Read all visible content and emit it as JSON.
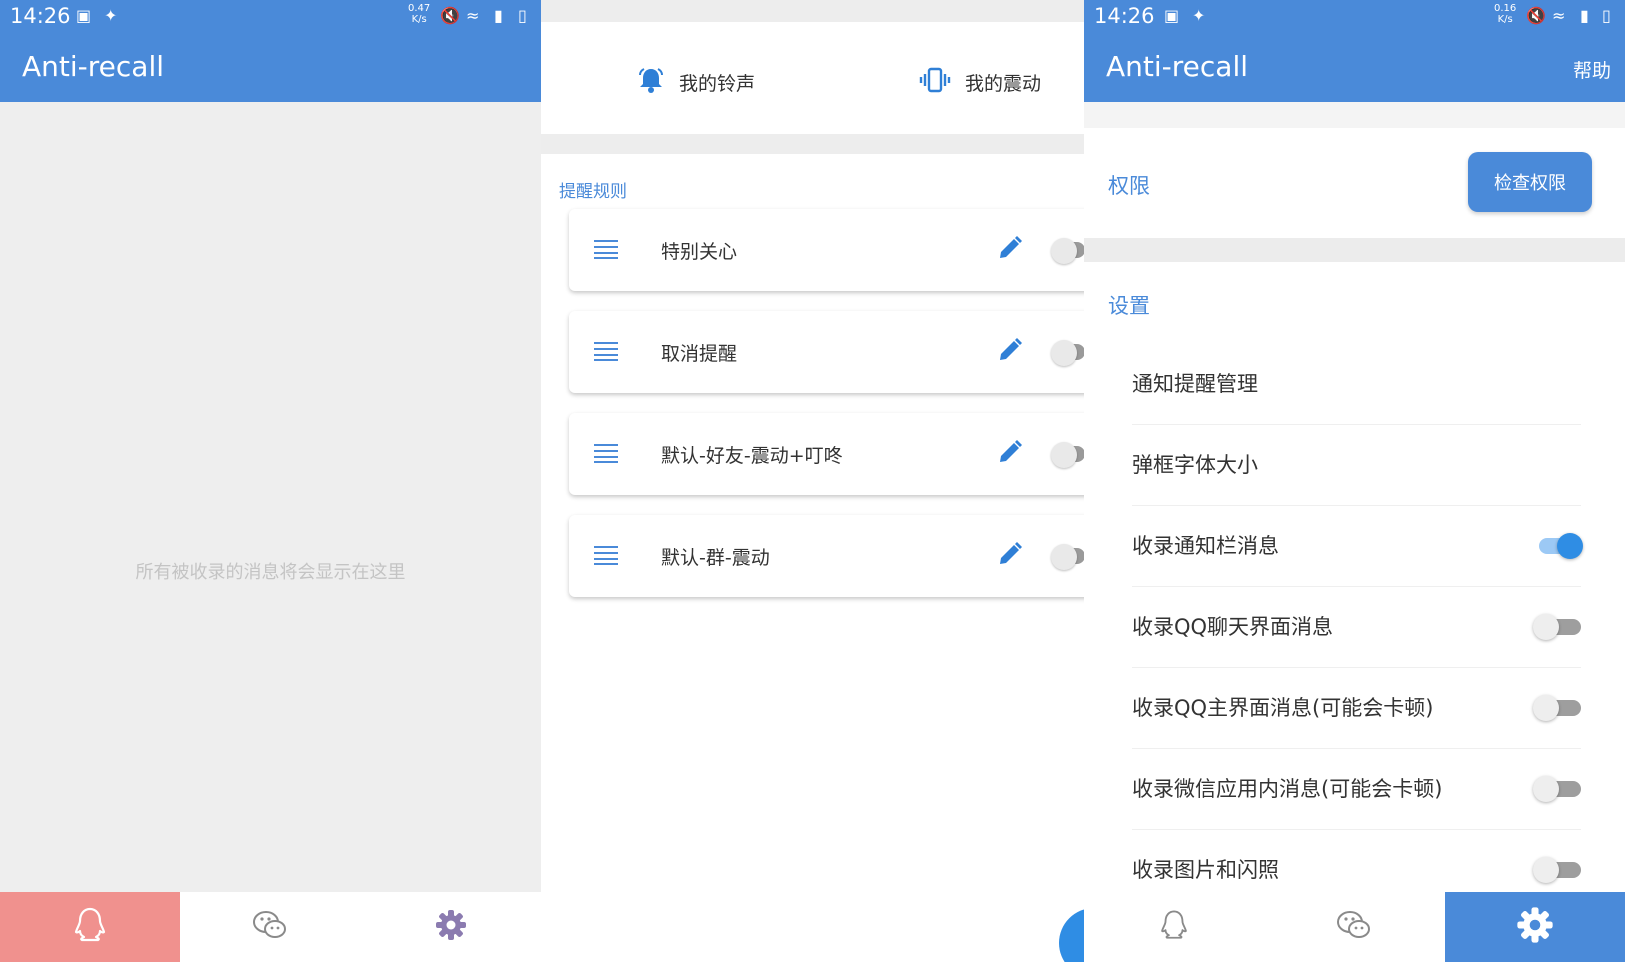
{
  "left_panel": {
    "status_time": "14:26",
    "status_speed": "0.47\nK/s",
    "title": "Anti-recall",
    "empty_hint": "所有被收录的消息将会显示在这里",
    "bottom_nav": [
      {
        "icon": "qq-penguin-icon",
        "active": true
      },
      {
        "icon": "wechat-icon",
        "active": false
      },
      {
        "icon": "gear-icon",
        "active": false
      }
    ]
  },
  "middle_panel": {
    "my_ringtone": "我的铃声",
    "my_vibration": "我的震动",
    "rules_section": "提醒规则",
    "rules": [
      {
        "name": "特别关心"
      },
      {
        "name": "取消提醒"
      },
      {
        "name": "默认-好友-震动+叮咚"
      },
      {
        "name": "默认-群-震动"
      }
    ]
  },
  "right_panel": {
    "status_time": "14:26",
    "status_speed": "0.16\nK/s",
    "title": "Anti-recall",
    "help": "帮助",
    "permissions_label": "权限",
    "check_permissions": "检查权限",
    "settings_label": "设置",
    "settings": [
      {
        "label": "通知提醒管理",
        "toggle": null
      },
      {
        "label": "弹框字体大小",
        "toggle": null
      },
      {
        "label": "收录通知栏消息",
        "toggle": true
      },
      {
        "label": "收录QQ聊天界面消息",
        "toggle": false
      },
      {
        "label": "收录QQ主界面消息(可能会卡顿)",
        "toggle": false
      },
      {
        "label": "收录微信应用内消息(可能会卡顿)",
        "toggle": false
      },
      {
        "label": "收录图片和闪照",
        "toggle": false
      }
    ]
  },
  "colors": {
    "primary": "#4a8ad9",
    "accent_blue": "#2f8de4",
    "active_pink": "#f0918e",
    "gear_purple": "#8b7bb0"
  }
}
